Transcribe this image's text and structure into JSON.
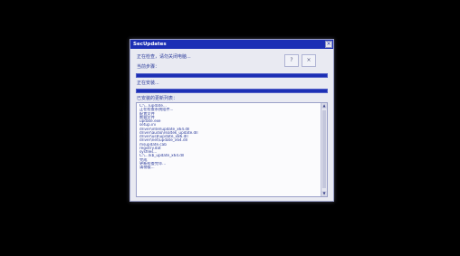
{
  "dialog": {
    "title": "SecUpdates",
    "close_label": "×",
    "status_line_1": "正在检查，请勿关闭电脑...",
    "status_line_2": "当前步骤：",
    "status_line_3": "正在安装...",
    "list_label": "已安装的更新列表：",
    "button_a_label": "?",
    "button_b_label": "×"
  },
  "progress": {
    "bar1_fraction": 1.0,
    "bar2_fraction": 1.0
  },
  "list": {
    "items": [
      "C:\\...\\update...",
      "正在检查系统组件...",
      "配置文件",
      "数据文件",
      "update.exe",
      "setup.ini",
      "driver\\intel\\update_x64.dll",
      "driver\\audio\\realtek_update.dll",
      "driver\\usb\\update_x86.dll",
      "driver\\net\\update_x64.dll",
      "msupdate.cab",
      "registry.dat",
      "sysfiles...",
      "C:\\...\\kb_update_x64.dll",
      "完成",
      "更新检查完毕...",
      "请稍候..."
    ]
  },
  "icons": {
    "close": "close-icon",
    "scroll_up": "chevron-up-icon",
    "scroll_down": "chevron-down-icon"
  },
  "colors": {
    "titlebar": "#1c2fb5",
    "screen_bg": "#000000",
    "dialog_bg": "#e9eaf2"
  }
}
